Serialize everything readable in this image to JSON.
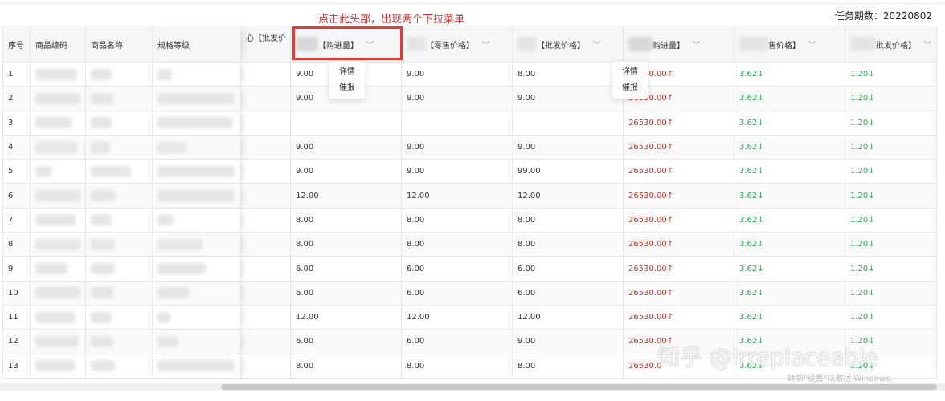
{
  "annotation": "点击此头部，出现两个下拉菜单",
  "period": "任务期数：20220802",
  "columns": [
    "序号",
    "商品编码",
    "商品名称",
    "规格等级",
    "心【批发价",
    "【购进量】",
    "【零售价格】",
    "【批发价格】",
    "购进量】",
    "售价格】",
    "批发价格】"
  ],
  "dropdown": [
    "详情",
    "催报"
  ],
  "rows": [
    {
      "idx": "1",
      "v1": "9.00",
      "v2": "9.00",
      "v3": "8.00",
      "v4": "26530.00↑",
      "v5": "3.62↓",
      "v6": "1.20↓"
    },
    {
      "idx": "2",
      "v1": "9.00",
      "v2": "9.00",
      "v3": "9.00",
      "v4": "26530.00↑",
      "v5": "3.62↓",
      "v6": "1.20↓"
    },
    {
      "idx": "3",
      "v1": "",
      "v2": "",
      "v3": "",
      "v4": "26530.00↑",
      "v5": "3.62↓",
      "v6": "1.20↓"
    },
    {
      "idx": "4",
      "v1": "9.00",
      "v2": "9.00",
      "v3": "9.00",
      "v4": "26530.00↑",
      "v5": "3.62↓",
      "v6": "1.20↓"
    },
    {
      "idx": "5",
      "v1": "9.00",
      "v2": "9.00",
      "v3": "99.00",
      "v4": "26530.00↑",
      "v5": "3.62↓",
      "v6": "1.20↓"
    },
    {
      "idx": "6",
      "v1": "12.00",
      "v2": "12.00",
      "v3": "12.00",
      "v4": "26530.00↑",
      "v5": "3.62↓",
      "v6": "1.20↓"
    },
    {
      "idx": "7",
      "v1": "8.00",
      "v2": "8.00",
      "v3": "8.00",
      "v4": "26530.00↑",
      "v5": "3.62↓",
      "v6": "1.20↓"
    },
    {
      "idx": "8",
      "v1": "8.00",
      "v2": "8.00",
      "v3": "8.00",
      "v4": "26530.00↑",
      "v5": "3.62↓",
      "v6": "1.20↓"
    },
    {
      "idx": "9",
      "v1": "6.00",
      "v2": "6.00",
      "v3": "6.00",
      "v4": "26530.00↑",
      "v5": "3.62↓",
      "v6": "1.20↓"
    },
    {
      "idx": "10",
      "v1": "6.00",
      "v2": "6.00",
      "v3": "6.00",
      "v4": "26530.00↑",
      "v5": "3.62↓",
      "v6": "1.20↓"
    },
    {
      "idx": "11",
      "v1": "12.00",
      "v2": "12.00",
      "v3": "12.00",
      "v4": "26530.00↑",
      "v5": "3.62↓",
      "v6": "1.20↓"
    },
    {
      "idx": "12",
      "v1": "6.00",
      "v2": "6.00",
      "v3": "9.00",
      "v4": "26530.00↑",
      "v5": "3.62↓",
      "v6": "1.20↓"
    },
    {
      "idx": "13",
      "v1": "8.00",
      "v2": "8.00",
      "v3": "8.00",
      "v4": "26530.0",
      "v5": "3.62↓",
      "v6": "1.20↓"
    }
  ],
  "watermark": "知乎 @Irreplaceable",
  "activation": "转到\"设置\"以激活 Windows。",
  "colors": {
    "highlight": "#e23c38",
    "up": "#c0392b",
    "down": "#2eaa4f"
  }
}
